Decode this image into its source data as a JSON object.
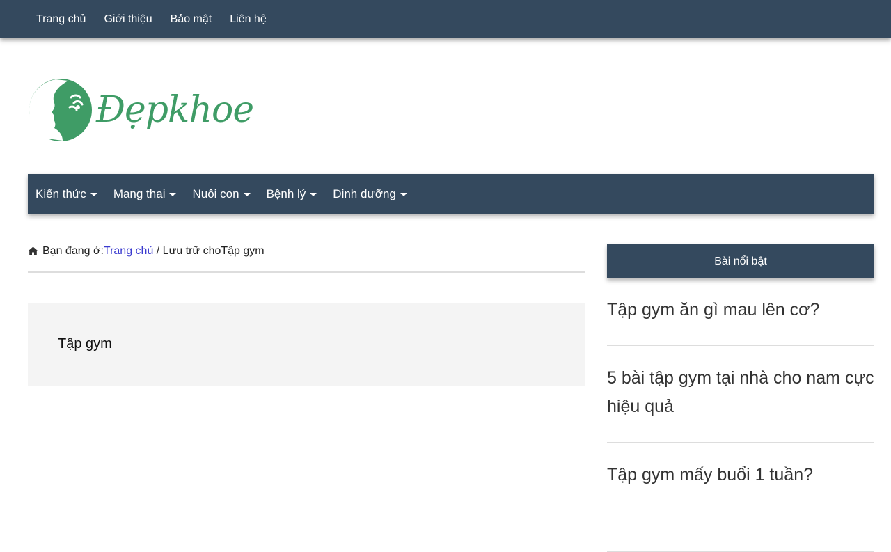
{
  "topnav": {
    "items": [
      {
        "label": "Trang chủ"
      },
      {
        "label": "Giới thiệu"
      },
      {
        "label": "Bảo mật"
      },
      {
        "label": "Liên hệ"
      }
    ]
  },
  "logo": {
    "text": "Đẹpkhoe",
    "color": "#3f9c66"
  },
  "mainnav": {
    "items": [
      {
        "label": "Kiến thức"
      },
      {
        "label": "Mang thai"
      },
      {
        "label": "Nuôi con"
      },
      {
        "label": "Bệnh lý"
      },
      {
        "label": "Dinh dưỡng"
      }
    ]
  },
  "breadcrumb": {
    "prefix": "Bạn đang ở:",
    "home_link": "Trang chủ",
    "rest": " / Lưu trữ choTập gym"
  },
  "archive": {
    "title": "Tập gym"
  },
  "sidebar": {
    "heading": "Bài nổi bật",
    "posts": [
      {
        "title": "Tập gym ăn gì mau lên cơ?"
      },
      {
        "title": "5 bài tập gym tại nhà cho nam cực hiệu quả"
      },
      {
        "title": "Tập gym mấy buổi 1 tuần?"
      },
      {
        "title": ""
      }
    ]
  },
  "colors": {
    "nav_bg": "#34495e",
    "link": "#3b3bcf",
    "archive_bg": "#f4f4f4"
  },
  "icons": {
    "breadcrumb": "home-icon",
    "dropdown": "caret-down-icon"
  }
}
